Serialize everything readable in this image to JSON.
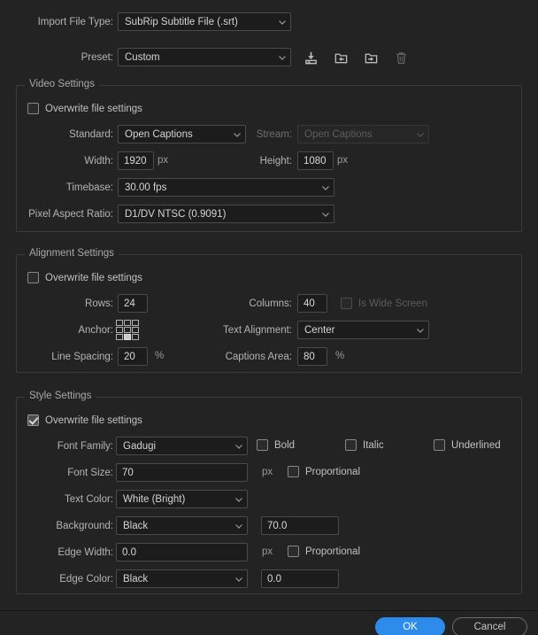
{
  "top": {
    "import_file_type_label": "Import File Type:",
    "import_file_type_value": "SubRip Subtitle File (.srt)",
    "preset_label": "Preset:",
    "preset_value": "Custom",
    "tools": [
      {
        "name": "save-preset-icon",
        "title": "Save Preset"
      },
      {
        "name": "import-preset-icon",
        "title": "Import Preset"
      },
      {
        "name": "export-preset-icon",
        "title": "Export Preset"
      },
      {
        "name": "delete-preset-icon",
        "title": "Delete Preset"
      }
    ]
  },
  "video": {
    "title": "Video Settings",
    "overwrite_label": "Overwrite file settings",
    "overwrite_checked": false,
    "standard_label": "Standard:",
    "standard_value": "Open Captions",
    "stream_label": "Stream:",
    "stream_value": "Open Captions",
    "width_label": "Width:",
    "width_value": "1920",
    "width_unit": "px",
    "height_label": "Height:",
    "height_value": "1080",
    "height_unit": "px",
    "timebase_label": "Timebase:",
    "timebase_value": "30.00 fps",
    "par_label": "Pixel Aspect Ratio:",
    "par_value": "D1/DV NTSC (0.9091)"
  },
  "alignment": {
    "title": "Alignment Settings",
    "overwrite_label": "Overwrite file settings",
    "overwrite_checked": false,
    "rows_label": "Rows:",
    "rows_value": "24",
    "columns_label": "Columns:",
    "columns_value": "40",
    "wide_screen_label": "Is Wide Screen",
    "wide_screen_checked": false,
    "anchor_label": "Anchor:",
    "anchor_selected_index": 7,
    "text_alignment_label": "Text Alignment:",
    "text_alignment_value": "Center",
    "line_spacing_label": "Line Spacing:",
    "line_spacing_value": "20",
    "line_spacing_unit": "%",
    "captions_area_label": "Captions Area:",
    "captions_area_value": "80",
    "captions_area_unit": "%"
  },
  "style": {
    "title": "Style Settings",
    "overwrite_label": "Overwrite file settings",
    "overwrite_checked": true,
    "font_family_label": "Font Family:",
    "font_family_value": "Gadugi",
    "bold_label": "Bold",
    "bold_checked": false,
    "italic_label": "Italic",
    "italic_checked": false,
    "underlined_label": "Underlined",
    "underlined_checked": false,
    "font_size_label": "Font Size:",
    "font_size_value": "70",
    "font_size_unit": "px",
    "font_size_proportional_label": "Proportional",
    "font_size_proportional_checked": false,
    "text_color_label": "Text Color:",
    "text_color_value": "White (Bright)",
    "background_label": "Background:",
    "background_value": "Black",
    "background_opacity": "70.0",
    "edge_width_label": "Edge Width:",
    "edge_width_value": "0.0",
    "edge_width_unit": "px",
    "edge_width_proportional_label": "Proportional",
    "edge_width_proportional_checked": false,
    "edge_color_label": "Edge Color:",
    "edge_color_value": "Black",
    "edge_color_opacity": "0.0"
  },
  "footer": {
    "ok_label": "OK",
    "cancel_label": "Cancel"
  },
  "colors": {
    "window_bg": "#232323",
    "field_bg": "#1c1c1c",
    "field_border": "#4a4a4a",
    "group_border": "#3b3b3b",
    "text": "#c8c8c8",
    "accent": "#2d8ceb"
  }
}
